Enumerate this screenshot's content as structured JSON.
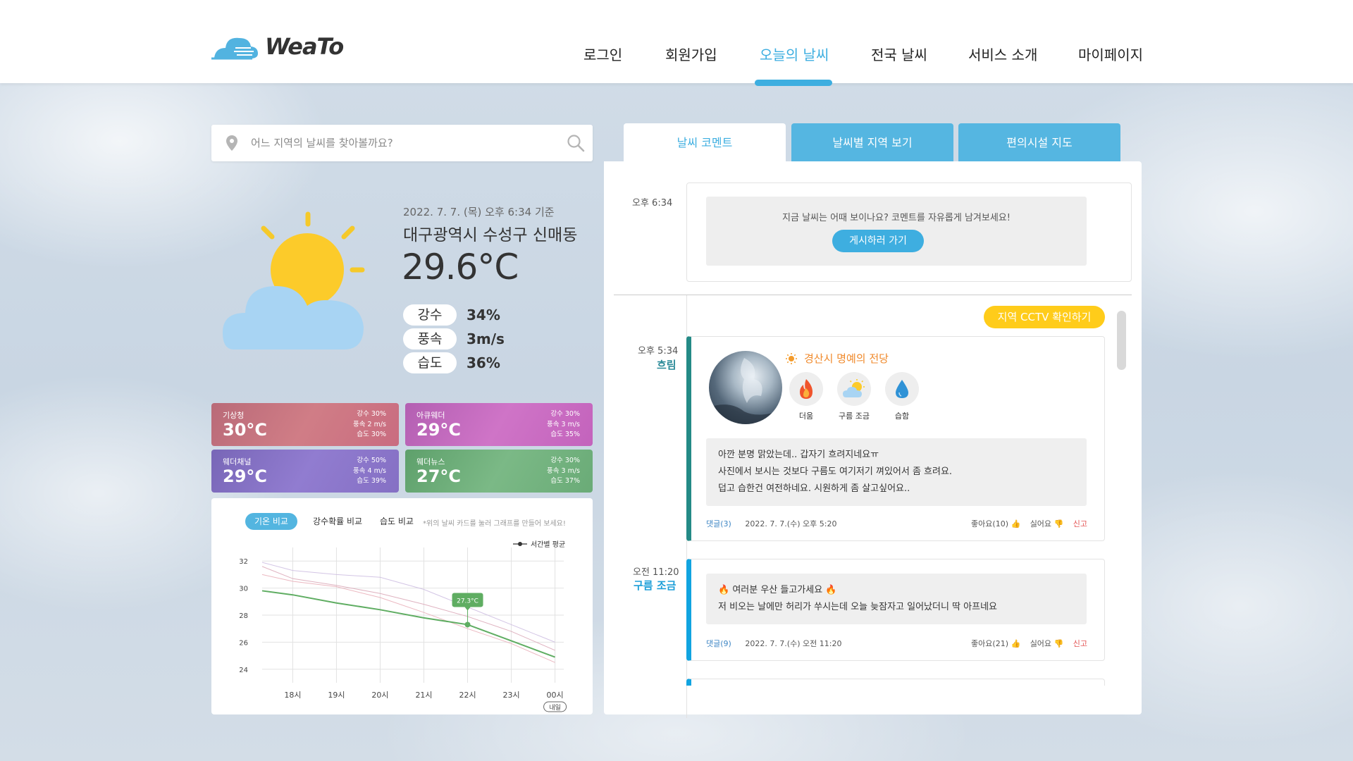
{
  "header": {
    "logo_text": "WeaTo",
    "nav": [
      "로그인",
      "회원가입",
      "오늘의 날씨",
      "전국 날씨",
      "서비스 소개",
      "마이페이지"
    ],
    "active_nav": "오늘의 날씨"
  },
  "search": {
    "placeholder": "어느 지역의 날씨를 찾아볼까요?",
    "pin_icon": "location-pin-icon",
    "search_icon": "magnifier-icon"
  },
  "current": {
    "timestamp": "2022. 7. 7. (목) 오후 6:34 기준",
    "location": "대구광역시 수성구 신매동",
    "temperature": "29.6°C",
    "illustration_icon": "sun-behind-cloud-icon",
    "stats": [
      {
        "label": "강수",
        "value": "34%"
      },
      {
        "label": "풍속",
        "value": "3m/s"
      },
      {
        "label": "습도",
        "value": "36%"
      }
    ]
  },
  "sources": [
    {
      "name": "기상청",
      "temp": "30°C",
      "rain": "강수 30%",
      "wind": "풍속 2 m/s",
      "humidity": "습도 30%",
      "color": "#c9707c"
    },
    {
      "name": "아큐웨더",
      "temp": "29°C",
      "rain": "강수 30%",
      "wind": "풍속 3 m/s",
      "humidity": "습도 35%",
      "color": "#c768c0"
    },
    {
      "name": "웨더채널",
      "temp": "29°C",
      "rain": "강수 50%",
      "wind": "풍속 4 m/s",
      "humidity": "습도 39%",
      "color": "#8a74c4"
    },
    {
      "name": "웨더뉴스",
      "temp": "27°C",
      "rain": "강수 30%",
      "wind": "풍속 3 m/s",
      "humidity": "습도 37%",
      "color": "#6fb07c"
    }
  ],
  "chart_panel": {
    "tabs": [
      "기온 비교",
      "강수확률 비교",
      "습도 비교"
    ],
    "active_tab": "기온 비교",
    "hint": "*위의 날씨 카드를 눌러 그래프를 만들어 보세요!",
    "tomorrow_label": "내일"
  },
  "chart_data": {
    "type": "line",
    "categories": [
      "18시",
      "19시",
      "20시",
      "21시",
      "22시",
      "23시",
      "00시"
    ],
    "ylim": [
      23,
      33
    ],
    "yticks": [
      24,
      26,
      28,
      30,
      32
    ],
    "legend": "서간별 평균",
    "legend_position": "top-right",
    "grid": true,
    "series": [
      {
        "name": "서간별 평균",
        "x": [
          17.3,
          18,
          19,
          20,
          21,
          22,
          23,
          24
        ],
        "values": [
          29.8,
          29.5,
          28.9,
          28.4,
          27.8,
          27.3,
          26.1,
          24.9
        ],
        "color": "#5fad62"
      },
      {
        "x": [
          17.3,
          18,
          19,
          20,
          21,
          22,
          23,
          24
        ],
        "values": [
          31.6,
          30.7,
          30.2,
          29.6,
          28.8,
          27.9,
          26.8,
          25.4
        ],
        "color": "#d9a5b5"
      },
      {
        "x": [
          17.3,
          18,
          19,
          20,
          21,
          22,
          23,
          24
        ],
        "values": [
          31.9,
          31.3,
          31.0,
          30.8,
          29.9,
          28.6,
          27.3,
          26.0
        ],
        "color": "#cbbbe0"
      },
      {
        "x": [
          17.3,
          18,
          19,
          20,
          21,
          22,
          23,
          24
        ],
        "values": [
          31.0,
          30.5,
          30.1,
          29.3,
          28.2,
          27.0,
          25.9,
          24.5
        ],
        "color": "#e7aab5"
      }
    ],
    "highlight": {
      "x": 22,
      "value": 27.3,
      "label": "27.3°C"
    }
  },
  "right_tabs": [
    "날씨 코멘트",
    "날씨별 지역 보기",
    "편의시설 지도"
  ],
  "active_right_tab": "날씨 코멘트",
  "prompt": {
    "time": "오후 6:34",
    "text": "지금 날씨는 어때 보이나요? 코멘트를 자유롭게 남겨보세요!",
    "button": "게시하러 가기"
  },
  "cctv_button": "지역 CCTV 확인하기",
  "posts": [
    {
      "time": "오후 5:34",
      "weather": "흐림",
      "location": "경산시 명예의 전당",
      "tags": [
        {
          "label": "더움",
          "icon": "fire-icon"
        },
        {
          "label": "구름 조금",
          "icon": "partly-cloudy-icon"
        },
        {
          "label": "습함",
          "icon": "water-drop-icon"
        }
      ],
      "lines": [
        "아깐 분명 맑았는데.. 갑자기 흐려지네요ㅠ",
        "사진에서 보시는 것보다 구름도 여기저기 껴있어서 좀 흐려요.",
        "덥고 습한건 여전하네요. 시원하게 좀 살고싶어요.."
      ],
      "comments": "댓글(3)",
      "date": "2022. 7. 7.(수) 오후 5:20",
      "likes": "좋아요(10) 👍",
      "dislikes": "싫어요 👎",
      "report": "신고"
    },
    {
      "time": "오전 11:20",
      "weather": "구름 조금",
      "lines": [
        "🔥 여러분 우산 들고가세요 🔥",
        "저 비오는 날에만 허리가 쑤시는데 오늘 늦잠자고 일어났더니 딱 아프네요"
      ],
      "comments": "댓글(9)",
      "date": "2022. 7. 7.(수) 오전 11:20",
      "likes": "좋아요(21) 👍",
      "dislikes": "싫어요 👎",
      "report": "신고"
    }
  ]
}
